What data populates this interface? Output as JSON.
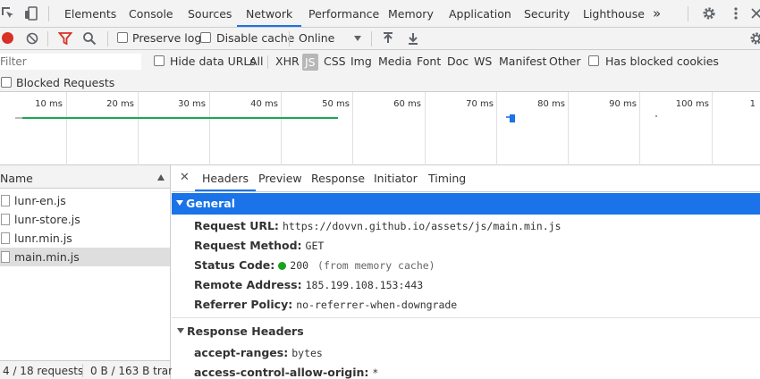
{
  "tabs": [
    "Elements",
    "Console",
    "Sources",
    "Network",
    "Performance",
    "Memory",
    "Application",
    "Security",
    "Lighthouse"
  ],
  "active_tab": "Network",
  "overflow_glyph": "»",
  "toolbar": {
    "preserve_log": "Preserve log",
    "disable_cache": "Disable cache",
    "throttle": "Online"
  },
  "filter": {
    "placeholder": "Filter",
    "hide_data_urls": "Hide data URLs",
    "types": [
      "All",
      "XHR",
      "JS",
      "CSS",
      "Img",
      "Media",
      "Font",
      "Doc",
      "WS",
      "Manifest",
      "Other"
    ],
    "selected_type": "JS",
    "has_blocked_cookies": "Has blocked cookies",
    "blocked_requests": "Blocked Requests"
  },
  "timeline": {
    "ticks": [
      "10 ms",
      "20 ms",
      "30 ms",
      "40 ms",
      "50 ms",
      "60 ms",
      "70 ms",
      "80 ms",
      "90 ms",
      "100 ms",
      "1"
    ]
  },
  "requests": {
    "header": "Name",
    "items": [
      "lunr-en.js",
      "lunr-store.js",
      "lunr.min.js",
      "main.min.js"
    ],
    "selected": "main.min.js",
    "count": "4 / 18 requests",
    "transferred": "0 B / 163 B trans"
  },
  "details": {
    "close_glyph": "✕",
    "tabs": [
      "Headers",
      "Preview",
      "Response",
      "Initiator",
      "Timing"
    ],
    "active_tab": "Headers",
    "general_title": "General",
    "general": {
      "request_url_label": "Request URL:",
      "request_url": "https://dovvn.github.io/assets/js/main.min.js",
      "request_method_label": "Request Method:",
      "request_method": "GET",
      "status_code_label": "Status Code:",
      "status_code": "200",
      "status_note": "(from memory cache)",
      "remote_address_label": "Remote Address:",
      "remote_address": "185.199.108.153:443",
      "referrer_policy_label": "Referrer Policy:",
      "referrer_policy": "no-referrer-when-downgrade"
    },
    "response_headers_title": "Response Headers",
    "response_headers": [
      {
        "k": "accept-ranges:",
        "v": "bytes"
      },
      {
        "k": "access-control-allow-origin:",
        "v": "*"
      }
    ]
  },
  "colors": {
    "accent": "#1a73e8",
    "record": "#d93025",
    "filter_funnel": "#d93025",
    "status_ok": "#19a11f"
  }
}
